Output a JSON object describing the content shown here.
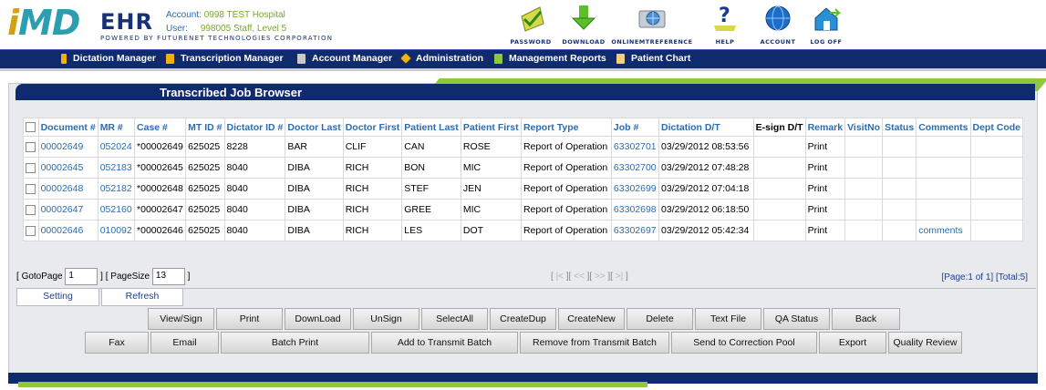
{
  "brand": {
    "logo_i": "i",
    "logo_md": "MD",
    "logo_ehr": "EHR",
    "powered_by": "POWERED BY FUTURENET TECHNOLOGIES CORPORATION"
  },
  "account": {
    "account_key": "Account:",
    "account_value": "0998 TEST Hospital",
    "user_key": "User:",
    "user_value": "998005 Staff, Level 5"
  },
  "top_icons": [
    {
      "label": "PASSWORD",
      "icon": "password-icon"
    },
    {
      "label": "DOWNLOAD",
      "icon": "download-icon"
    },
    {
      "label": "ONLINEMTREFERENCE",
      "icon": "online-reference-icon"
    },
    {
      "label": "HELP",
      "icon": "help-icon"
    },
    {
      "label": "ACCOUNT",
      "icon": "globe-icon"
    },
    {
      "label": "LOG OFF",
      "icon": "logoff-icon"
    }
  ],
  "nav": [
    {
      "label": "Dictation Manager",
      "icon": "microphone-icon",
      "color": "#f0b400"
    },
    {
      "label": "Transcription Manager",
      "icon": "document-icon",
      "color": "#f0b400"
    },
    {
      "label": "Account Manager",
      "icon": "ledger-icon",
      "color": "#c9c9c9"
    },
    {
      "label": "Administration",
      "icon": "diamond-icon",
      "color": "#f0b400"
    },
    {
      "label": "Management Reports",
      "icon": "spreadsheet-icon",
      "color": "#8dc63f"
    },
    {
      "label": "Patient Chart",
      "icon": "clipboard-icon",
      "color": "#f0d080"
    }
  ],
  "panel": {
    "title": "Transcribed Job Browser"
  },
  "table": {
    "headers": [
      "Document #",
      "MR #",
      "Case #",
      "MT ID #",
      "Dictator ID #",
      "Doctor Last",
      "Doctor First",
      "Patient Last",
      "Patient First",
      "Report Type",
      "Job #",
      "Dictation D/T",
      "E-sign D/T",
      "Remark",
      "VisitNo",
      "Status",
      "Comments",
      "Dept Code"
    ],
    "rows": [
      {
        "document": "00002649",
        "mr": "052024",
        "case": "*00002649",
        "mt_id": "625025",
        "dictator_id": "8228",
        "doctor_last": "BAR",
        "doctor_first": "CLIF",
        "patient_last": "CAN",
        "patient_first": "ROSE",
        "report_type": "Report of Operation",
        "job": "63302701",
        "dictation_dt": "03/29/2012 08:53:56",
        "esign_dt": "",
        "remark": "Print",
        "visit_no": "",
        "status": "",
        "comments": "",
        "dept_code": ""
      },
      {
        "document": "00002645",
        "mr": "052183",
        "case": "*00002645",
        "mt_id": "625025",
        "dictator_id": "8040",
        "doctor_last": "DIBA",
        "doctor_first": "RICH",
        "patient_last": "BON",
        "patient_first": "MIC",
        "report_type": "Report of Operation",
        "job": "63302700",
        "dictation_dt": "03/29/2012 07:48:28",
        "esign_dt": "",
        "remark": "Print",
        "visit_no": "",
        "status": "",
        "comments": "",
        "dept_code": ""
      },
      {
        "document": "00002648",
        "mr": "052182",
        "case": "*00002648",
        "mt_id": "625025",
        "dictator_id": "8040",
        "doctor_last": "DIBA",
        "doctor_first": "RICH",
        "patient_last": "STEF",
        "patient_first": "JEN",
        "report_type": "Report of Operation",
        "job": "63302699",
        "dictation_dt": "03/29/2012 07:04:18",
        "esign_dt": "",
        "remark": "Print",
        "visit_no": "",
        "status": "",
        "comments": "",
        "dept_code": ""
      },
      {
        "document": "00002647",
        "mr": "052160",
        "case": "*00002647",
        "mt_id": "625025",
        "dictator_id": "8040",
        "doctor_last": "DIBA",
        "doctor_first": "RICH",
        "patient_last": "GREE",
        "patient_first": "MIC",
        "report_type": "Report of Operation",
        "job": "63302698",
        "dictation_dt": "03/29/2012 06:18:50",
        "esign_dt": "",
        "remark": "Print",
        "visit_no": "",
        "status": "",
        "comments": "",
        "dept_code": ""
      },
      {
        "document": "00002646",
        "mr": "010092",
        "case": "*00002646",
        "mt_id": "625025",
        "dictator_id": "8040",
        "doctor_last": "DIBA",
        "doctor_first": "RICH",
        "patient_last": "LES",
        "patient_first": "DOT",
        "report_type": "Report of Operation",
        "job": "63302697",
        "dictation_dt": "03/29/2012 05:42:34",
        "esign_dt": "",
        "remark": "Print",
        "visit_no": "",
        "status": "",
        "comments": "comments",
        "dept_code": ""
      }
    ]
  },
  "pager": {
    "goto_label": "GotoPage",
    "goto_value": "1",
    "pagesize_label": "PageSize",
    "pagesize_value": "13",
    "page_info": "[Page:1 of 1] [Total:5]"
  },
  "tabs": {
    "setting": "Setting",
    "refresh": "Refresh"
  },
  "buttons_row1": [
    "View/Sign",
    "Print",
    "DownLoad",
    "UnSign",
    "SelectAll",
    "CreateDup",
    "CreateNew",
    "Delete",
    "Text File",
    "QA Status",
    "Back"
  ],
  "buttons_row2": [
    "Fax",
    "Email",
    "Batch Print",
    "Add to Transmit Batch",
    "Remove from Transmit Batch",
    "Send to Correction Pool",
    "Export",
    "Quality Review"
  ]
}
